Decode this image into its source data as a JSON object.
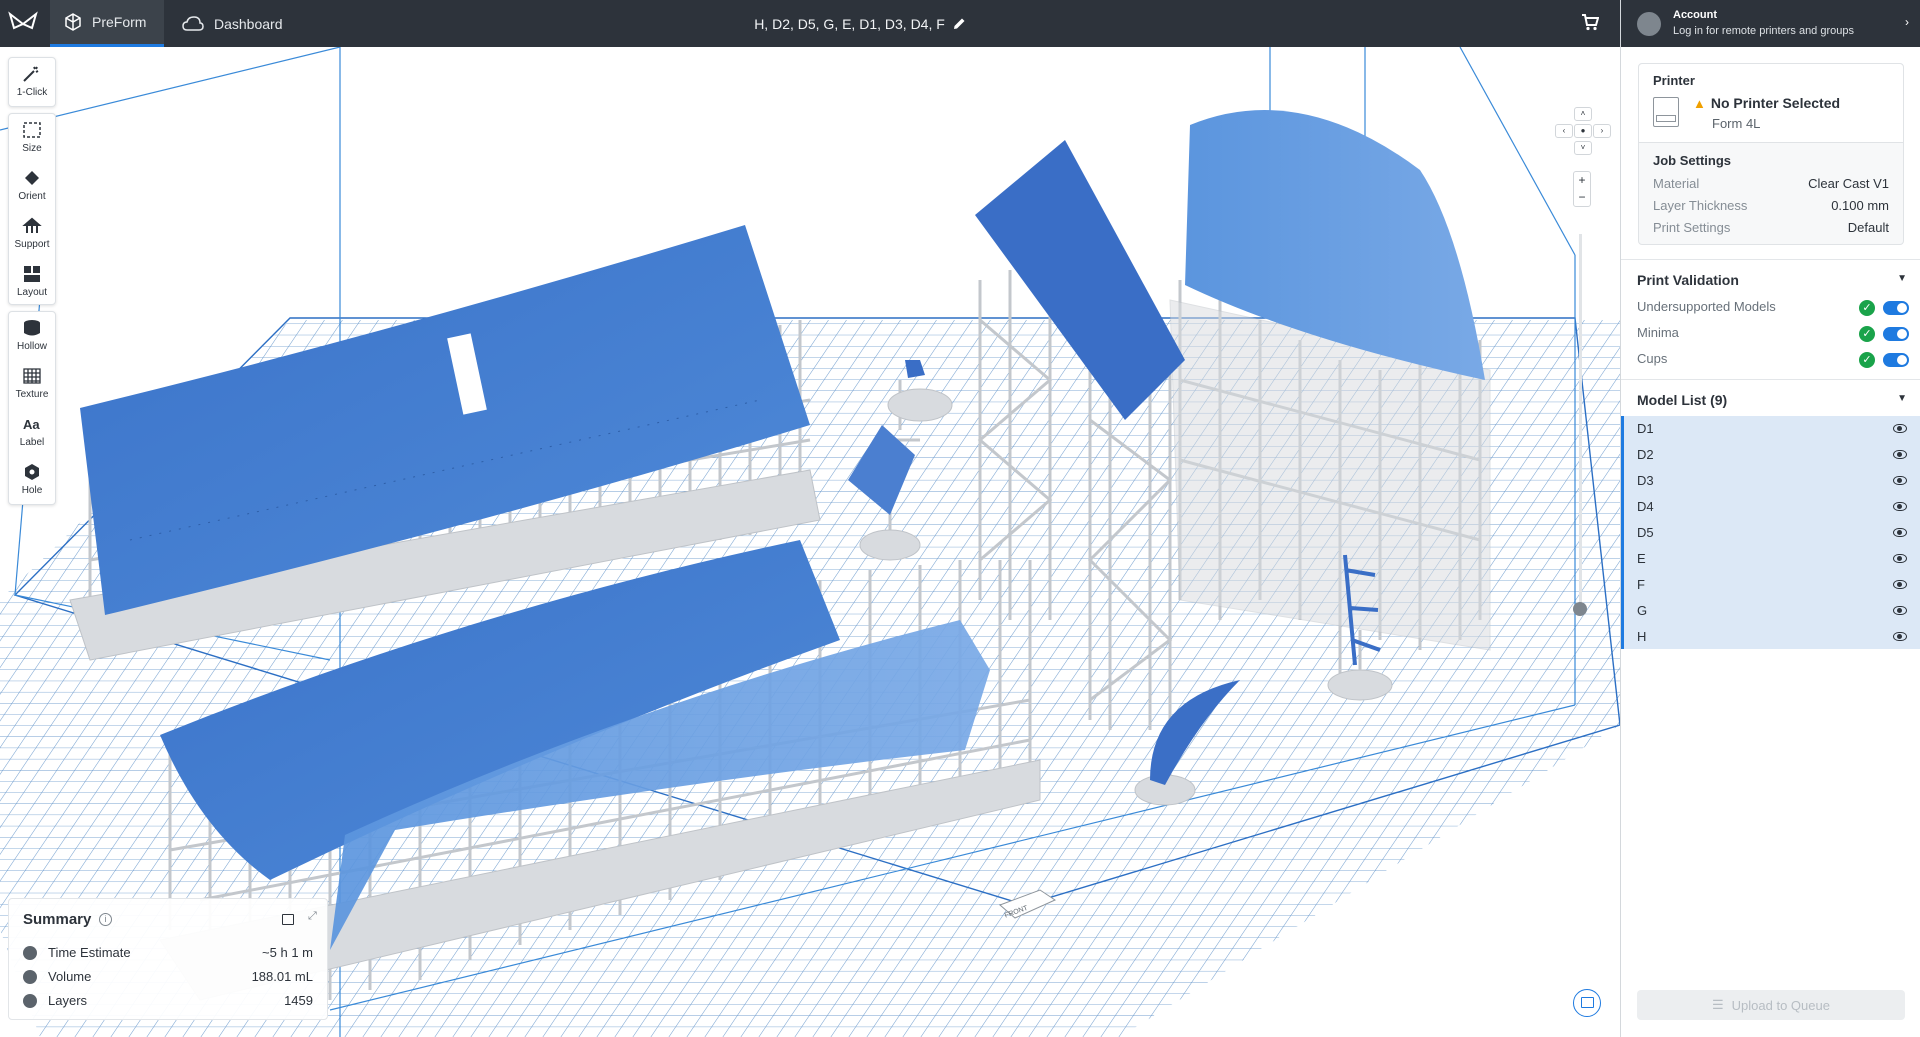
{
  "app": {
    "tabs": [
      {
        "label": "PreForm",
        "icon": "preform-cube-icon",
        "active": true
      },
      {
        "label": "Dashboard",
        "icon": "cloud-icon",
        "active": false
      }
    ],
    "job_name": "H, D2, D5, G, E, D1, D3, D4, F"
  },
  "account": {
    "title": "Account",
    "subtitle": "Log in for remote printers and groups"
  },
  "printer": {
    "heading": "Printer",
    "status": "No Printer Selected",
    "model": "Form 4L"
  },
  "job_settings": {
    "heading": "Job Settings",
    "rows": [
      {
        "key": "Material",
        "value": "Clear Cast V1"
      },
      {
        "key": "Layer Thickness",
        "value": "0.100 mm"
      },
      {
        "key": "Print Settings",
        "value": "Default"
      }
    ]
  },
  "print_validation": {
    "heading": "Print Validation",
    "items": [
      {
        "label": "Undersupported Models",
        "passed": true,
        "enabled": true
      },
      {
        "label": "Minima",
        "passed": true,
        "enabled": true
      },
      {
        "label": "Cups",
        "passed": true,
        "enabled": true
      }
    ]
  },
  "model_list": {
    "heading": "Model List (9)",
    "items": [
      "D1",
      "D2",
      "D3",
      "D4",
      "D5",
      "E",
      "F",
      "G",
      "H"
    ]
  },
  "upload_button": "Upload to Queue",
  "toolbar": {
    "groups": [
      [
        {
          "label": "1-Click",
          "icon": "magic-wand-icon"
        }
      ],
      [
        {
          "label": "Size",
          "icon": "size-icon"
        },
        {
          "label": "Orient",
          "icon": "orient-icon"
        },
        {
          "label": "Support",
          "icon": "support-icon"
        },
        {
          "label": "Layout",
          "icon": "layout-icon"
        }
      ],
      [
        {
          "label": "Hollow",
          "icon": "hollow-icon"
        },
        {
          "label": "Texture",
          "icon": "texture-icon"
        },
        {
          "label": "Label",
          "icon": "label-icon"
        },
        {
          "label": "Hole",
          "icon": "hole-icon"
        }
      ]
    ]
  },
  "summary": {
    "title": "Summary",
    "rows": [
      {
        "key": "Time Estimate",
        "value": "~5 h 1 m",
        "icon": "clock-icon"
      },
      {
        "key": "Volume",
        "value": "188.01 mL",
        "icon": "volume-icon"
      },
      {
        "key": "Layers",
        "value": "1459",
        "icon": "layers-icon"
      }
    ]
  },
  "build_plate_label": "FRONT",
  "colors": {
    "topbar": "#2d333b",
    "accent": "#1e7ae0",
    "model_blue": "#3f7fd0",
    "support_grey": "#c9cdd2",
    "grid_line": "#5b8fc7",
    "check_green": "#1aa34a",
    "warning": "#f0a000"
  }
}
